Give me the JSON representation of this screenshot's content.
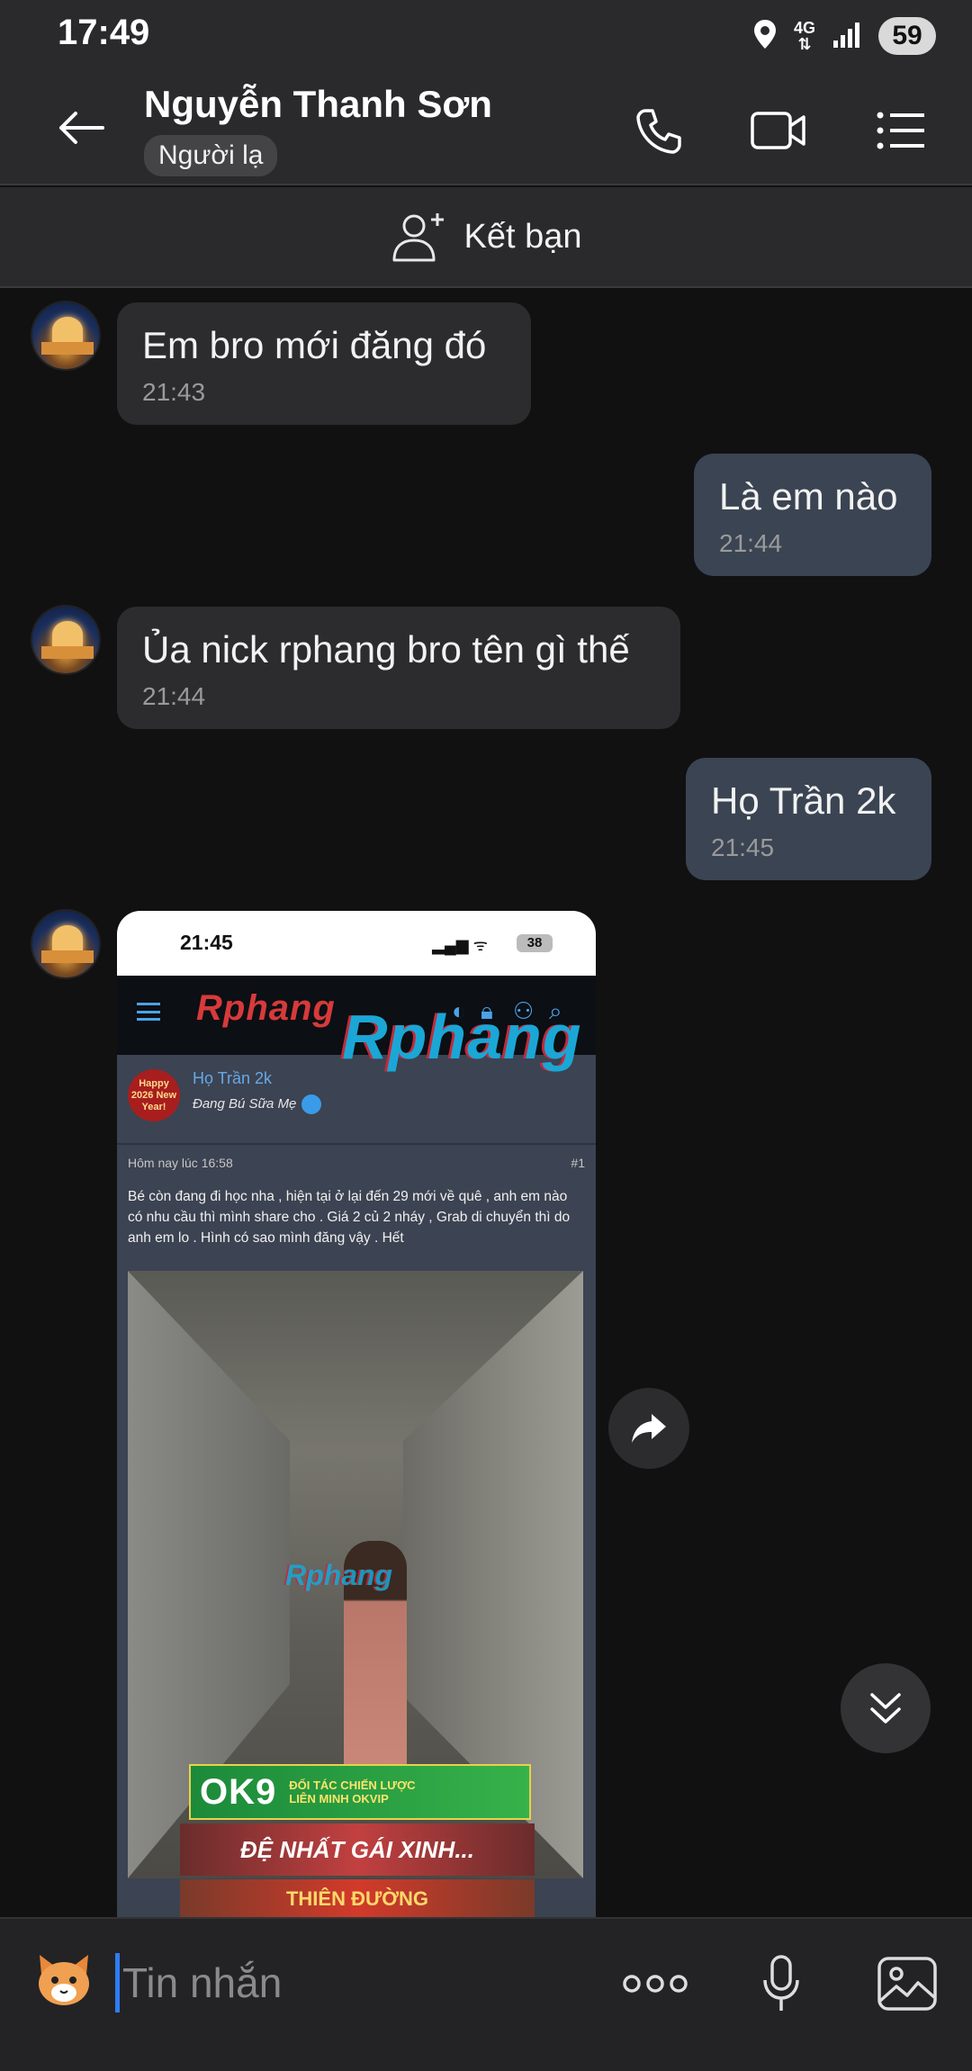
{
  "status_bar": {
    "time": "17:49",
    "network": "4G",
    "battery": "59"
  },
  "header": {
    "name": "Nguyễn Thanh Sơn",
    "tag": "Người lạ"
  },
  "add_friend": {
    "label": "Kết bạn"
  },
  "messages": [
    {
      "direction": "in",
      "text": "Em bro mới đăng đó",
      "time": "21:43"
    },
    {
      "direction": "out",
      "text": "Là em nào",
      "time": "21:44"
    },
    {
      "direction": "in",
      "text": "Ủa nick rphang bro tên gì thế",
      "time": "21:44"
    },
    {
      "direction": "out",
      "text": "Họ Trần 2k",
      "time": "21:45"
    }
  ],
  "image_message": {
    "status_time": "21:45",
    "battery": "38",
    "logo_small": "Rphang",
    "logo_big": "Rphang",
    "user_name": "Họ Trần 2k",
    "user_status": "Đang Bú Sữa Mẹ",
    "avatar_text": "Happy 2026 New Year!",
    "post_time": "Hôm nay lúc 16:58",
    "post_number": "#1",
    "post_body": "Bé còn đang đi học nha , hiện tại ở lại đến 29 mới về quê , anh em nào có nhu cầu thì mình share cho . Giá 2 củ 2 nháy , Grab di chuyển thì do anh em lo . Hình có sao mình đăng vậy . Hết",
    "watermark": "Rphang",
    "ad1_big": "OK9",
    "ad1_small": "ĐỐI TÁC CHIẾN LƯỢC",
    "ad1_small2": "LIÊN MINH OKVIP",
    "ad2": "ĐỆ NHẤT GÁI XINH...",
    "ad3": "THIÊN ĐƯỜNG"
  },
  "input": {
    "placeholder": "Tin nhắn"
  },
  "colors": {
    "background": "#111112",
    "bubble_in": "#2c2c2e",
    "bubble_out": "#3b4452",
    "accent": "#2f7df4"
  }
}
